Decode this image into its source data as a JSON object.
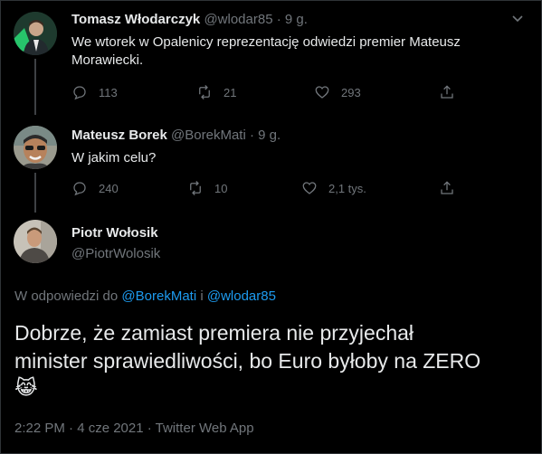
{
  "tweets": [
    {
      "name": "Tomasz Włodarczyk",
      "handle": "@wlodar85",
      "time": "9 g.",
      "text": "We wtorek w Opalenicy reprezentację odwiedzi premier Mateusz Morawiecki.",
      "replies": "113",
      "retweets": "21",
      "likes": "293"
    },
    {
      "name": "Mateusz Borek",
      "handle": "@BorekMati",
      "time": "9 g.",
      "text": "W jakim celu?",
      "replies": "240",
      "retweets": "10",
      "likes": "2,1 tys."
    }
  ],
  "main_tweet": {
    "name": "Piotr Wołosik",
    "handle": "@PiotrWolosik",
    "reply_prefix": "W odpowiedzi do",
    "reply_user1": "@BorekMati",
    "reply_and": "i",
    "reply_user2": "@wlodar85",
    "text_line1": "Dobrze, że zamiast premiera nie przyjechał",
    "text_line2": "minister sprawiedliwości, bo Euro byłoby na ZERO",
    "emoji": "😹",
    "timestamp": "2:22 PM · 4 cze 2021 · Twitter Web App"
  },
  "icons": {
    "reply": "reply-icon",
    "retweet": "retweet-icon",
    "like": "heart-icon",
    "share": "share-icon",
    "more": "more-icon"
  },
  "colors": {
    "background": "#000000",
    "link": "#1d9bf0",
    "muted": "#71767b",
    "text": "#e7e9ea"
  }
}
